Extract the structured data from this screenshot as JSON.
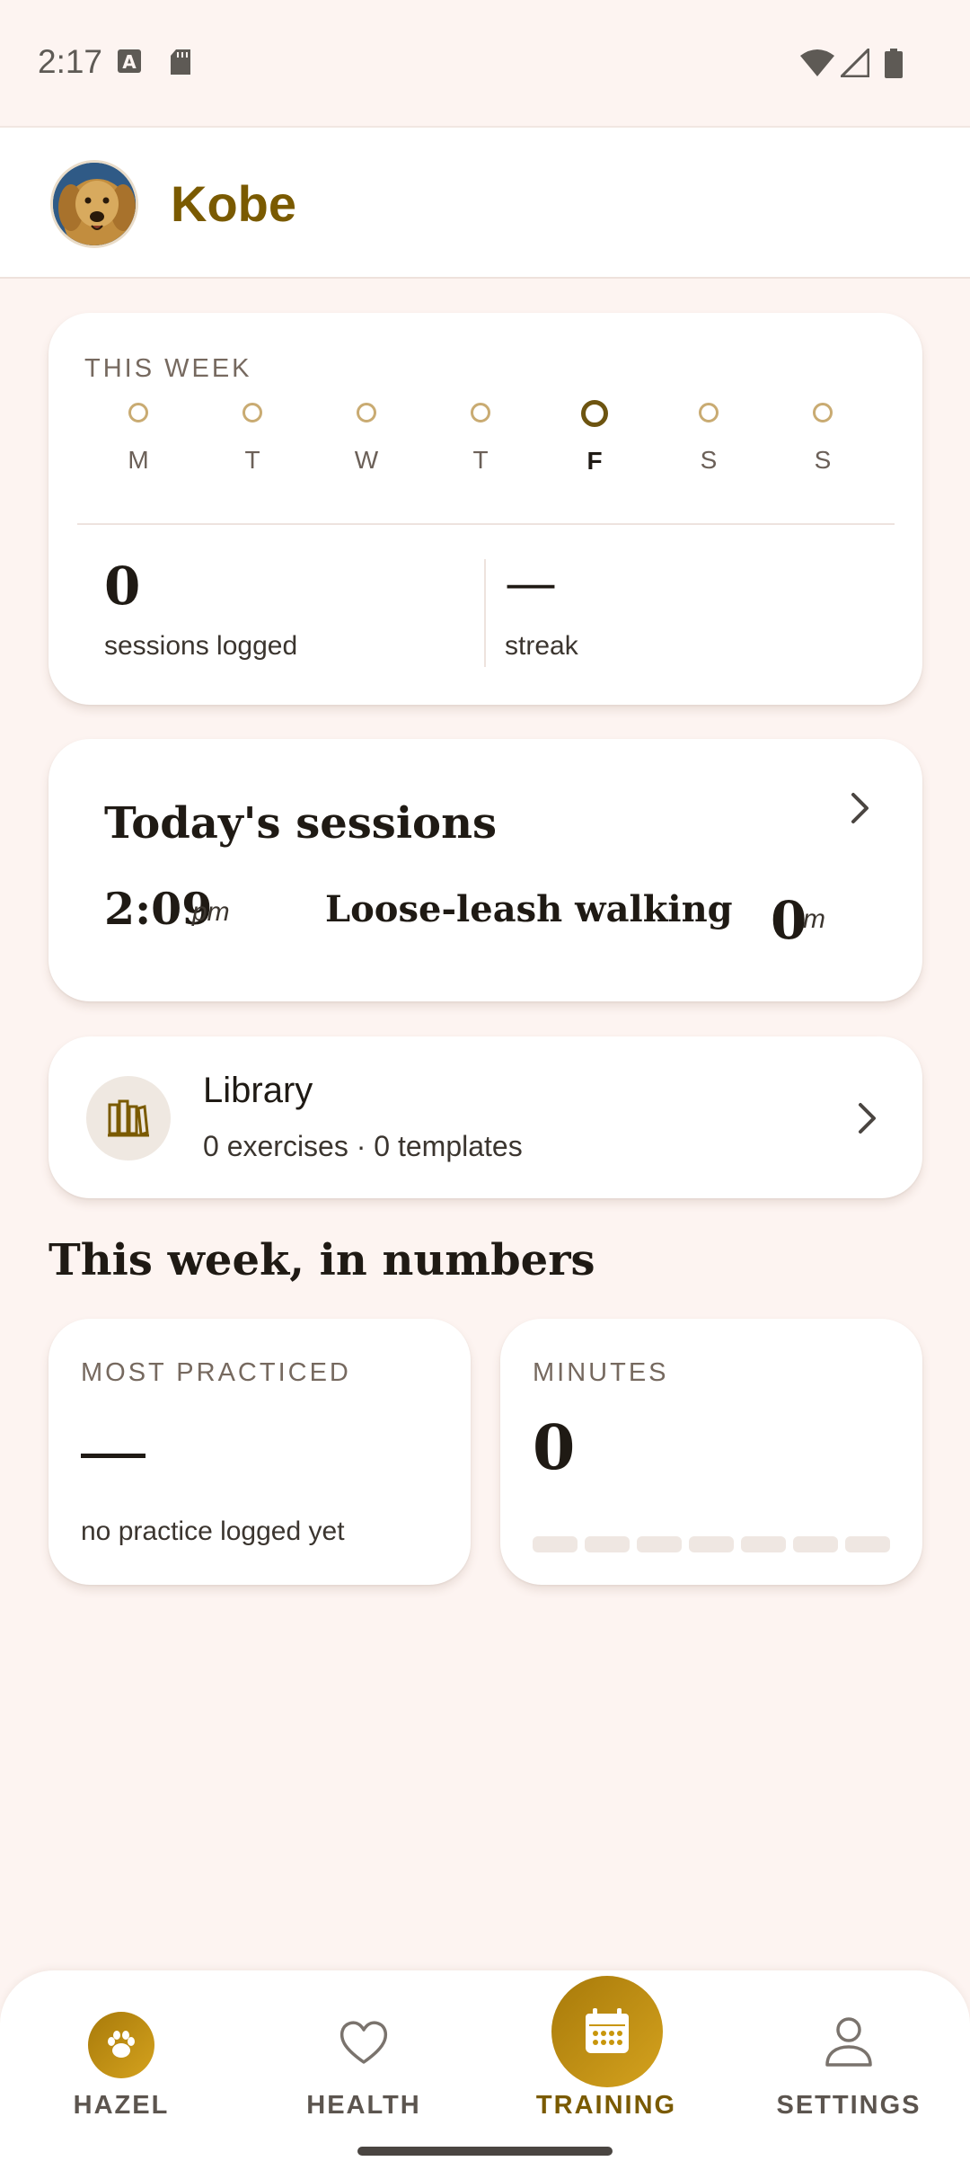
{
  "status_bar": {
    "time": "2:17"
  },
  "header": {
    "pet_name": "Kobe"
  },
  "this_week": {
    "label": "THIS WEEK",
    "days": [
      {
        "letter": "M",
        "active": false
      },
      {
        "letter": "T",
        "active": false
      },
      {
        "letter": "W",
        "active": false
      },
      {
        "letter": "T",
        "active": false
      },
      {
        "letter": "F",
        "active": true
      },
      {
        "letter": "S",
        "active": false
      },
      {
        "letter": "S",
        "active": false
      }
    ],
    "sessions_count": "0",
    "sessions_label": "sessions logged",
    "streak_value": "—",
    "streak_label": "streak"
  },
  "today": {
    "title": "Today's sessions",
    "session": {
      "time": "2:09",
      "time_unit": "pm",
      "name": "Loose-leash walking",
      "duration": "0",
      "duration_unit": "m"
    }
  },
  "library": {
    "title": "Library",
    "subtitle": "0 exercises · 0 templates",
    "icon": "books-icon"
  },
  "numbers": {
    "title": "This week, in numbers",
    "most_practiced": {
      "label": "MOST PRACTICED",
      "value": "—",
      "note": "no practice logged yet"
    },
    "minutes": {
      "label": "MINUTES",
      "value": "0",
      "bar_fill_fraction": 0
    }
  },
  "nav": {
    "items": [
      {
        "label": "HAZEL",
        "icon": "paw-icon",
        "active": false
      },
      {
        "label": "HEALTH",
        "icon": "heart-icon",
        "active": false
      },
      {
        "label": "TRAINING",
        "icon": "calendar-icon",
        "active": true
      },
      {
        "label": "SETTINGS",
        "icon": "person-icon",
        "active": false
      }
    ]
  },
  "colors": {
    "accent": "#7a5a00",
    "gold": "#c8960c",
    "background": "#fdf4f1"
  }
}
